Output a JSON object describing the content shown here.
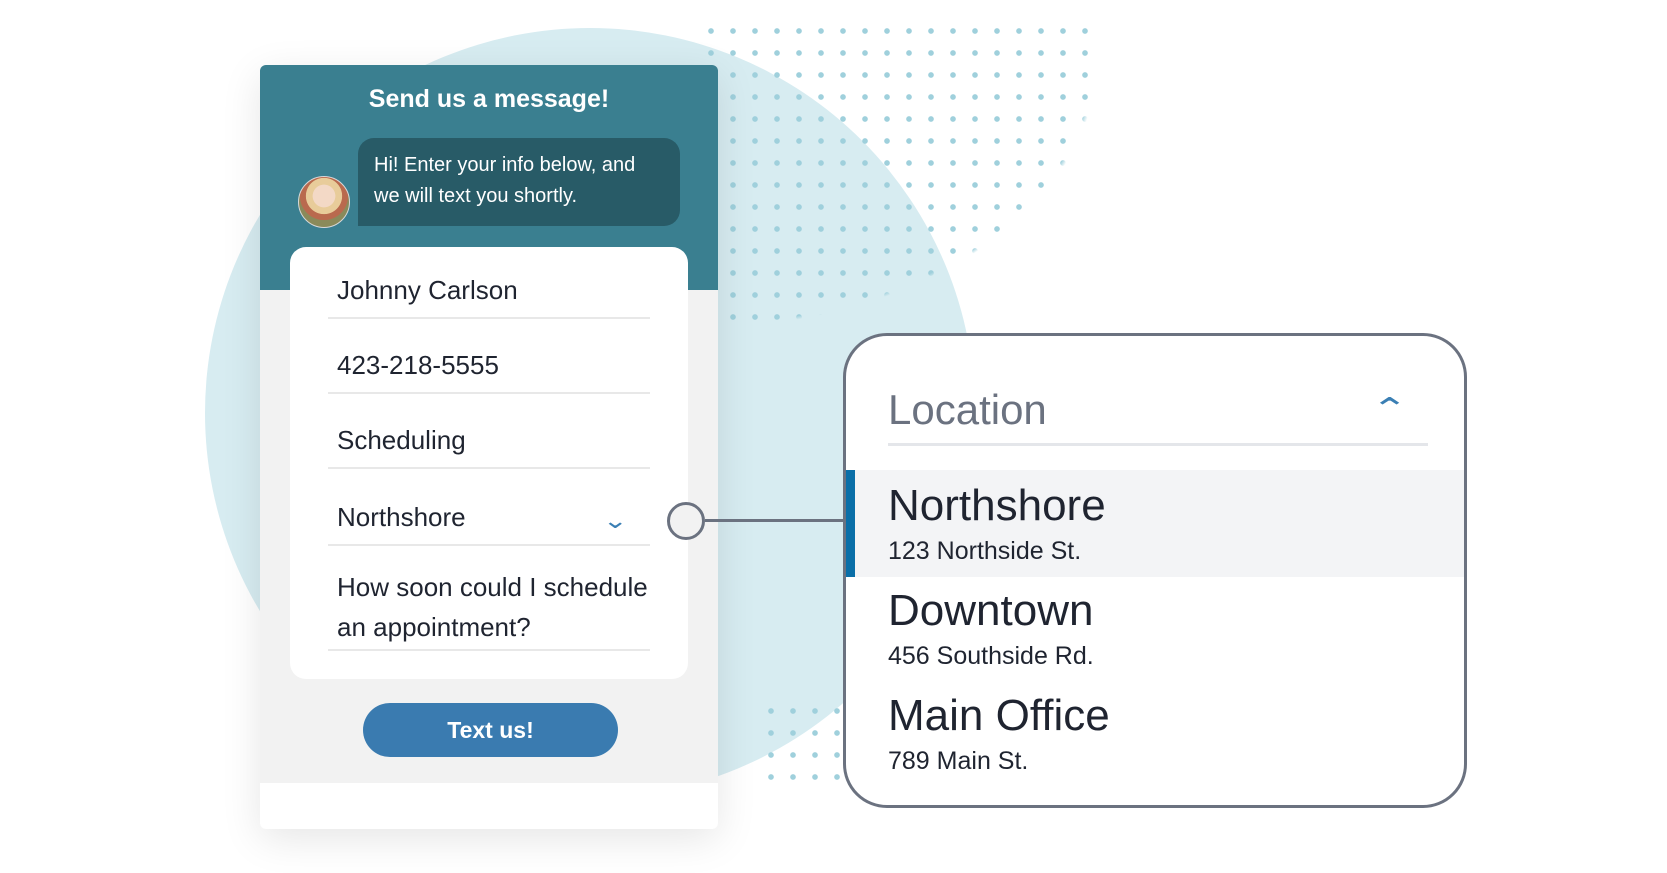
{
  "chat_widget": {
    "title": "Send us a message!",
    "greeting": "Hi! Enter your info below, and we will text you shortly.",
    "fields": {
      "name": "Johnny Carlson",
      "phone": "423-218-5555",
      "topic": "Scheduling",
      "location": "Northshore",
      "message": "How soon could I schedule an appointment?"
    },
    "submit_label": "Text us!"
  },
  "location_dropdown": {
    "label": "Location",
    "options": [
      {
        "name": "Northshore",
        "address": "123 Northside St.",
        "selected": true
      },
      {
        "name": "Downtown",
        "address": "456 Southside Rd.",
        "selected": false
      },
      {
        "name": "Main Office",
        "address": "789 Main St.",
        "selected": false
      }
    ]
  },
  "colors": {
    "header": "#3a7f90",
    "bubble": "#285b67",
    "button": "#3a7bb0",
    "selected_accent": "#0a6fa8"
  }
}
